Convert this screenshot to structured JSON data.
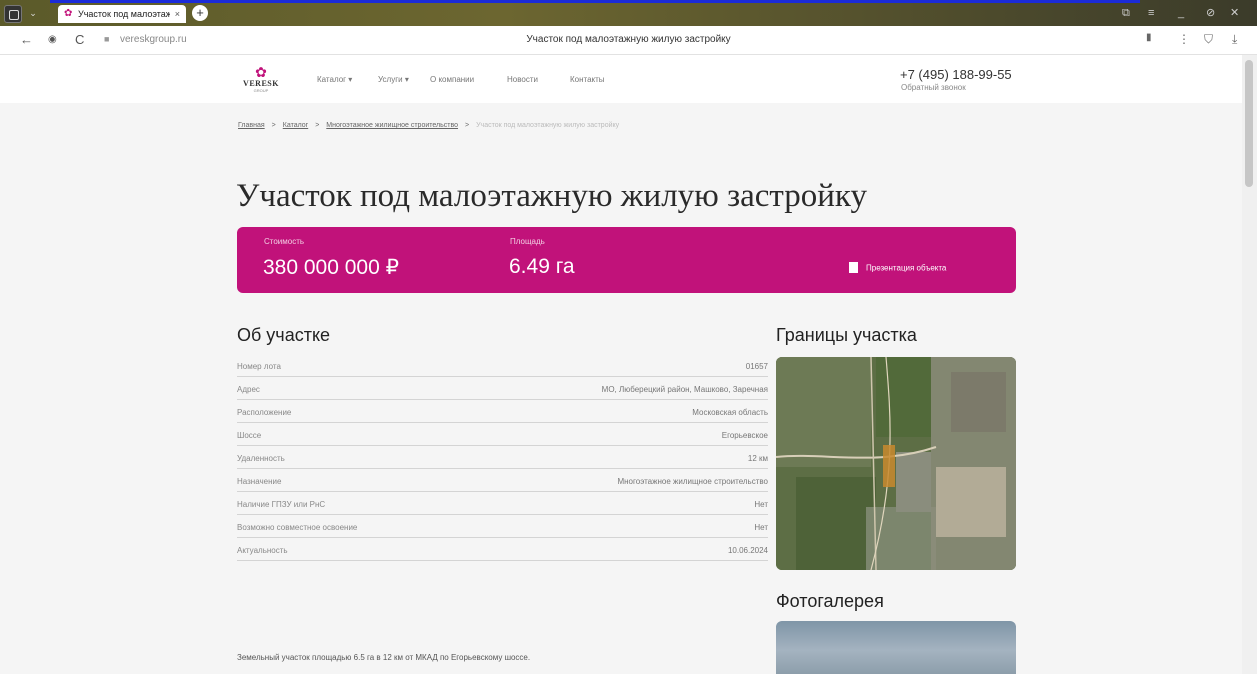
{
  "browser": {
    "tab_title": "Участок под малоэтажн",
    "tab_close": "×",
    "new_tab": "+",
    "url": "vereskgroup.ru",
    "page_title": "Участок под малоэтажную жилую застройку",
    "nav": {
      "back": "←",
      "reload": "C"
    },
    "icons": [
      "app-menu-icon",
      "back-icon",
      "history-icon",
      "reload-icon",
      "lock-icon",
      "bookmark-icon",
      "more-icon",
      "extension-icon",
      "download-icon"
    ]
  },
  "header": {
    "logo_name": "VERESK",
    "logo_sub": "GROUP",
    "menu": [
      "Каталог ▾",
      "Услуги ▾",
      "О компании",
      "Новости",
      "Контакты"
    ],
    "phone": "+7 (495) 188-99-55",
    "callback": "Обратный звонок"
  },
  "breadcrumbs": {
    "items": [
      "Главная",
      "Каталог",
      "Многоэтажное жилищное строительство"
    ],
    "separator": ">",
    "current": "Участок под малоэтажную жилую застройку"
  },
  "title": "Участок под малоэтажную жилую застройку",
  "banner": {
    "price_label": "Стоимость",
    "price": "380 000 000 ₽",
    "area_label": "Площадь",
    "area": "6.49 га",
    "presentation": "Презентация объекта",
    "color": "#c1127a"
  },
  "about": {
    "heading": "Об участке",
    "rows": [
      {
        "key": "Номер лота",
        "value": "01657"
      },
      {
        "key": "Адрес",
        "value": "МО, Люберецкий район, Машково, Заречная"
      },
      {
        "key": "Расположение",
        "value": "Московская область"
      },
      {
        "key": "Шоссе",
        "value": "Егорьевское"
      },
      {
        "key": "Удаленность",
        "value": "12 км"
      },
      {
        "key": "Назначение",
        "value": "Многоэтажное жилищное строительство"
      },
      {
        "key": "Наличие ГПЗУ или РнС",
        "value": "Нет"
      },
      {
        "key": "Возможно совместное освоение",
        "value": "Нет"
      },
      {
        "key": "Актуальность",
        "value": "10.06.2024"
      }
    ],
    "description": "Земельный участок площадью 6.5 га в 12 км от МКАД по Егорьевскому шоссе."
  },
  "borders_heading": "Границы участка",
  "gallery_heading": "Фотогалерея"
}
